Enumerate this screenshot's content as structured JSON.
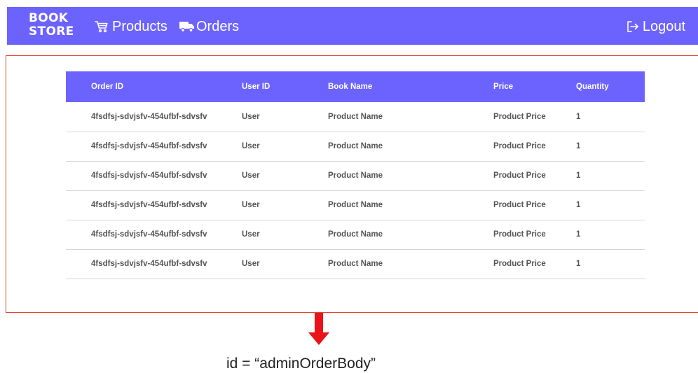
{
  "navbar": {
    "logo_line1": "BOOK",
    "logo_line2": "STORE",
    "products_label": "Products",
    "orders_label": "Orders",
    "logout_label": "Logout",
    "bg_color": "#6c63ff"
  },
  "table": {
    "headers": [
      "Order ID",
      "User ID",
      "Book Name",
      "Price",
      "Quantity"
    ],
    "rows": [
      [
        "4fsdfsj-sdvjsfv-454ufbf-sdvsfv",
        "User",
        "Product Name",
        "Product Price",
        "1"
      ],
      [
        "4fsdfsj-sdvjsfv-454ufbf-sdvsfv",
        "User",
        "Product Name",
        "Product Price",
        "1"
      ],
      [
        "4fsdfsj-sdvjsfv-454ufbf-sdvsfv",
        "User",
        "Product Name",
        "Product Price",
        "1"
      ],
      [
        "4fsdfsj-sdvjsfv-454ufbf-sdvsfv",
        "User",
        "Product Name",
        "Product Price",
        "1"
      ],
      [
        "4fsdfsj-sdvjsfv-454ufbf-sdvsfv",
        "User",
        "Product Name",
        "Product Price",
        "1"
      ],
      [
        "4fsdfsj-sdvjsfv-454ufbf-sdvsfv",
        "User",
        "Product Name",
        "Product Price",
        "1"
      ]
    ]
  },
  "annotation": {
    "caption": "id = “adminOrderBody”",
    "arrow_color": "#e8141a",
    "outline_color": "#e34234"
  },
  "icons": {
    "products": "cart-icon",
    "orders": "truck-icon",
    "logout": "logout-icon",
    "annotation": "down-arrow-icon"
  }
}
